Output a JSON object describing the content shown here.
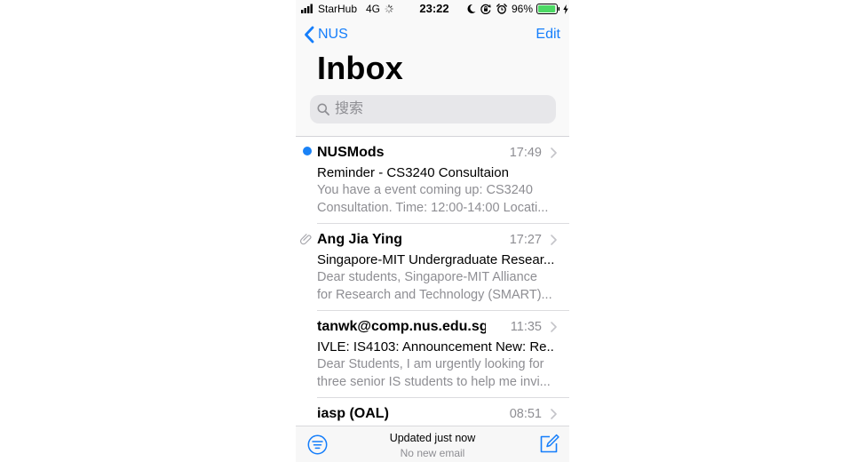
{
  "status_bar": {
    "carrier": "StarHub",
    "network": "4G",
    "time": "23:22",
    "battery_percent": "96%",
    "battery_level": 0.96,
    "icons": [
      "signal-bars-icon",
      "activity-spinner-icon",
      "moon-icon",
      "rotation-lock-icon",
      "alarm-icon",
      "battery-icon",
      "charging-bolt-icon"
    ]
  },
  "nav": {
    "back_label": "NUS",
    "edit_label": "Edit",
    "back_icon": "chevron-left-icon"
  },
  "title": "Inbox",
  "search": {
    "placeholder": "搜索",
    "icon": "search-icon"
  },
  "emails": [
    {
      "sender": "NUSMods",
      "time": "17:49",
      "subject": "Reminder - CS3240 Consultaion",
      "preview": [
        "You have a event coming up: CS3240",
        "Consultation. Time: 12:00-14:00 Locati..."
      ],
      "unread": true,
      "attachment": false
    },
    {
      "sender": "Ang Jia Ying",
      "time": "17:27",
      "subject": "Singapore-MIT Undergraduate Resear...",
      "preview": [
        "Dear students, Singapore-MIT Alliance",
        "for Research and Technology (SMART)..."
      ],
      "unread": false,
      "attachment": true
    },
    {
      "sender": "tanwk@comp.nus.edu.sg",
      "time": "11:35",
      "subject": "IVLE: IS4103: Announcement New: Re...",
      "preview": [
        "Dear Students, I am urgently looking for",
        "three senior IS students to help me invi..."
      ],
      "unread": false,
      "attachment": false
    },
    {
      "sender": "iasp (OAL)",
      "time": "08:51",
      "unread": false,
      "attachment": false
    }
  ],
  "toolbar": {
    "status": "Updated just now",
    "substatus": "No new email",
    "icons": [
      "filter-icon",
      "compose-icon"
    ]
  },
  "colors": {
    "accent": "#157efb",
    "unread_dot": "#1a82f6",
    "secondary_text": "#8e8e93",
    "battery_fill": "#4cd964"
  }
}
